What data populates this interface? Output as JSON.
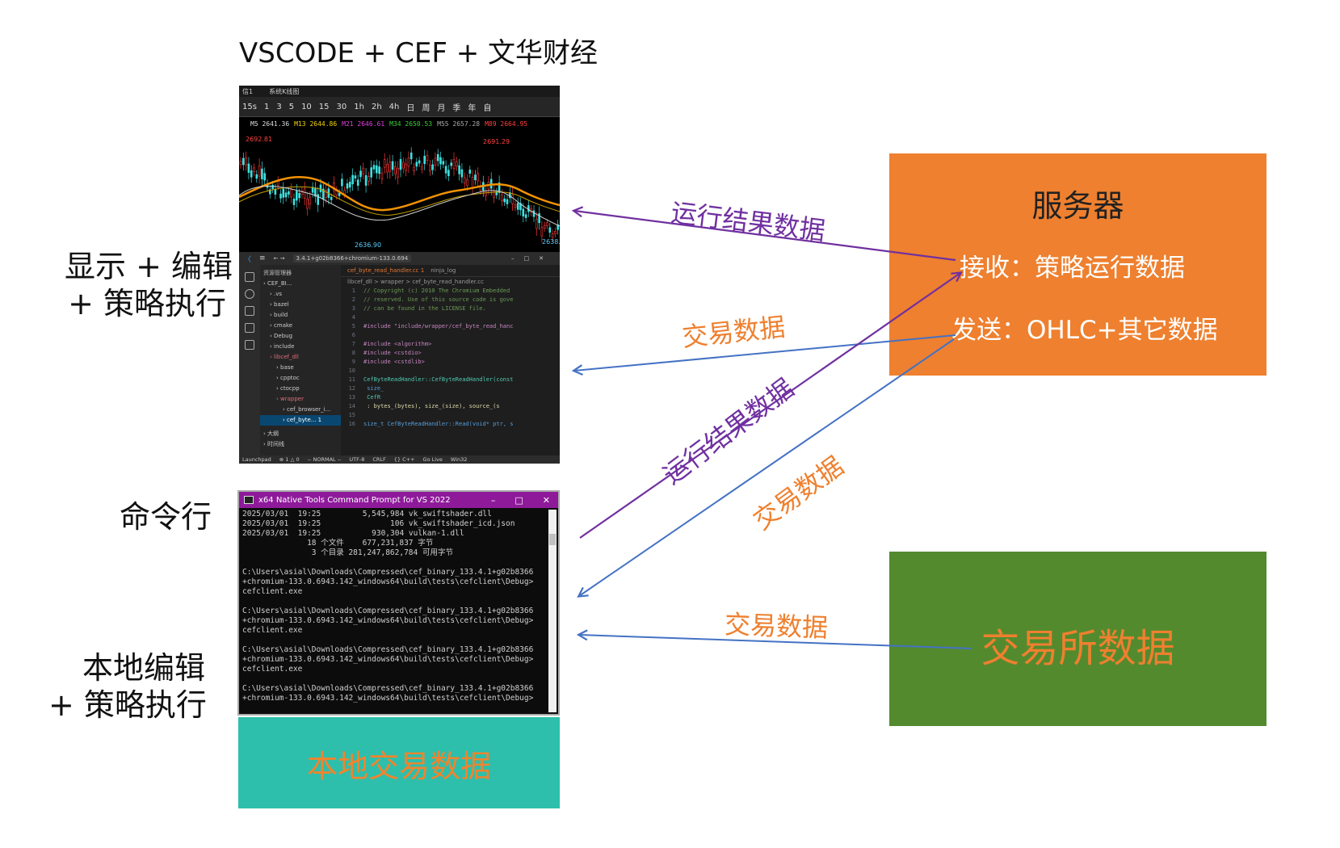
{
  "title": "VSCODE + CEF + 文华财经",
  "left_labels": {
    "display_edit_line1": "显示 + 编辑",
    "display_edit_line2": "+ 策略执行",
    "cmdline": "命令行",
    "local_edit_line1": "本地编辑",
    "local_edit_line2": "+ 策略执行"
  },
  "chart_panel": {
    "tabs": [
      "信1",
      "系统K线图"
    ],
    "toolbar": [
      "15s",
      "1",
      "3",
      "5",
      "10",
      "15",
      "30",
      "1h",
      "2h",
      "4h",
      "日",
      "周",
      "月",
      "季",
      "年",
      "自"
    ],
    "ma_values": [
      {
        "text": "M5 2641.36",
        "color": "#dddddd"
      },
      {
        "text": "M13 2644.86",
        "color": "#f5d60a"
      },
      {
        "text": "M21 2646.61",
        "color": "#e040e0"
      },
      {
        "text": "M34 2650.53",
        "color": "#3ad13a"
      },
      {
        "text": "M55 2657.28",
        "color": "#aaaaaa"
      },
      {
        "text": "M89 2664.95",
        "color": "#ff4040"
      }
    ],
    "price_high_left": "2692.81",
    "price_high_mid": "2691.29",
    "price_low": "2636.90",
    "price_low_right": "2638."
  },
  "vscode": {
    "title_text": "3.4.1+g02b8366+chromium-133.0.694",
    "explorer_header": "资源管理器",
    "explorer_items": [
      "CEF_BI...",
      ".vs",
      "bazel",
      "build",
      "cmake",
      "Debug",
      "include",
      "libcef_dll",
      "base",
      "cpptoc",
      "ctocpp",
      "wrapper",
      "cef_browser_i...",
      "cef_byte... 1",
      "大纲",
      "时间线"
    ],
    "tabs": [
      "cef_byte_read_handler.cc 1",
      "ninja_log"
    ],
    "breadcrumb": "libcef_dll > wrapper > cef_byte_read_handler.cc",
    "code_lines": [
      {
        "n": "1",
        "t": "// Copyright (c) 2010 The Chromium Embedded",
        "c": "#6a9955"
      },
      {
        "n": "2",
        "t": "// reserved. Use of this source code is gove",
        "c": "#6a9955"
      },
      {
        "n": "3",
        "t": "// can be found in the LICENSE file.",
        "c": "#6a9955"
      },
      {
        "n": "4",
        "t": "",
        "c": "#cccccc"
      },
      {
        "n": "5",
        "t": "#include \"include/wrapper/cef_byte_read_hanc",
        "c": "#c586c0"
      },
      {
        "n": "6",
        "t": "",
        "c": "#cccccc"
      },
      {
        "n": "7",
        "t": "#include <algorithm>",
        "c": "#c586c0"
      },
      {
        "n": "8",
        "t": "#include <cstdio>",
        "c": "#c586c0"
      },
      {
        "n": "9",
        "t": "#include <cstdlib>",
        "c": "#c586c0"
      },
      {
        "n": "10",
        "t": "",
        "c": "#cccccc"
      },
      {
        "n": "11",
        "t": "CefByteReadHandler::CefByteReadHandler(const",
        "c": "#4ec9b0"
      },
      {
        "n": "12",
        "t": "                                          size_",
        "c": "#569cd6"
      },
      {
        "n": "13",
        "t": "                                          CefR",
        "c": "#4ec9b0"
      },
      {
        "n": "14",
        "t": "    : bytes_(bytes), size_(size), source_(s",
        "c": "#dcdcaa"
      },
      {
        "n": "15",
        "t": "",
        "c": "#cccccc"
      },
      {
        "n": "16",
        "t": "size_t CefByteReadHandler::Read(void* ptr, s",
        "c": "#569cd6"
      }
    ],
    "status": [
      "Launchpad",
      "⊗ 1 △ 0",
      "-- NORMAL --",
      "UTF-8",
      "CRLF",
      "{} C++",
      "Go Live",
      "Win32"
    ]
  },
  "cmd": {
    "title": "x64 Native Tools Command Prompt for VS 2022",
    "lines": [
      "2025/03/01  19:25         5,545,984 vk_swiftshader.dll",
      "2025/03/01  19:25               106 vk_swiftshader_icd.json",
      "2025/03/01  19:25           930,304 vulkan-1.dll",
      "              18 个文件    677,231,837 字节",
      "               3 个目录 281,247,862,784 可用字节",
      "",
      "C:\\Users\\asial\\Downloads\\Compressed\\cef_binary_133.4.1+g02b8366",
      "+chromium-133.0.6943.142_windows64\\build\\tests\\cefclient\\Debug>",
      "cefclient.exe",
      "",
      "C:\\Users\\asial\\Downloads\\Compressed\\cef_binary_133.4.1+g02b8366",
      "+chromium-133.0.6943.142_windows64\\build\\tests\\cefclient\\Debug>",
      "cefclient.exe",
      "",
      "C:\\Users\\asial\\Downloads\\Compressed\\cef_binary_133.4.1+g02b8366",
      "+chromium-133.0.6943.142_windows64\\build\\tests\\cefclient\\Debug>",
      "cefclient.exe",
      "",
      "C:\\Users\\asial\\Downloads\\Compressed\\cef_binary_133.4.1+g02b8366",
      "+chromium-133.0.6943.142_windows64\\build\\tests\\cefclient\\Debug>"
    ]
  },
  "local_box": "本地交易数据",
  "server_box": {
    "title": "服务器",
    "receive": "接收：策略运行数据",
    "send": "发送：OHLC+其它数据"
  },
  "exchange_box": "交易所数据",
  "arrow_labels": {
    "run_result_top": "运行结果数据",
    "trade_data_top": "交易数据",
    "run_result_diag": "运行结果数据",
    "trade_data_diag": "交易数据",
    "trade_data_bottom": "交易数据"
  },
  "colors": {
    "purple": "#7030a0",
    "blue": "#4472c4",
    "orange": "#ee802f",
    "server_fill": "#ee802f",
    "exchange_fill": "#548a2e",
    "local_fill": "#2dbfac"
  }
}
